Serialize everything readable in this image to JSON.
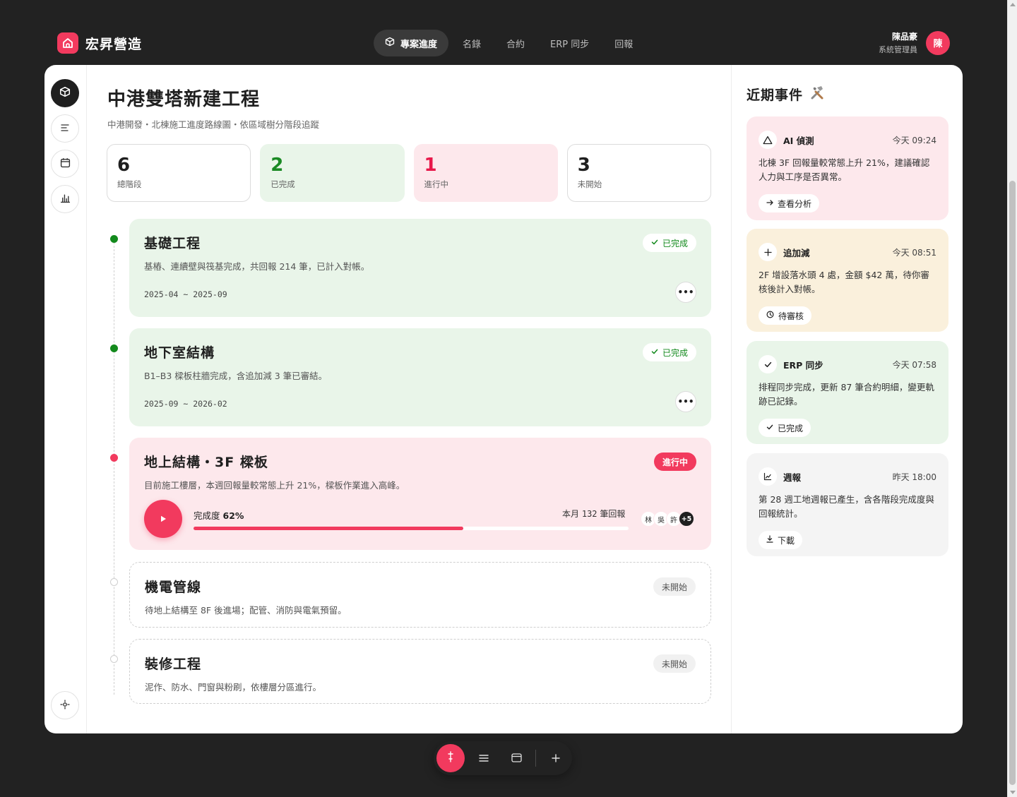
{
  "brand": {
    "name": "宏昇營造",
    "accent": "#f23a5e"
  },
  "nav": {
    "items": [
      {
        "label": "專案進度",
        "active": true
      },
      {
        "label": "名錄",
        "active": false
      },
      {
        "label": "合約",
        "active": false
      },
      {
        "label": "ERP 同步",
        "active": false
      },
      {
        "label": "回報",
        "active": false
      }
    ]
  },
  "user": {
    "name": "陳品豪",
    "role": "系統管理員",
    "initial": "陳"
  },
  "rail": {
    "icons": [
      "cube-icon",
      "list-icon",
      "calendar-icon",
      "bar-chart-icon",
      "locate-icon"
    ]
  },
  "project": {
    "title": "中港雙塔新建工程",
    "subtitle": "中港開發・北棟施工進度路線圖・依區域樹分階段追蹤"
  },
  "stats": [
    {
      "value": "6",
      "label": "總階段"
    },
    {
      "value": "2",
      "label": "已完成"
    },
    {
      "value": "1",
      "label": "進行中"
    },
    {
      "value": "3",
      "label": "未開始"
    }
  ],
  "phases": [
    {
      "title": "基礎工程",
      "status": "已完成",
      "desc": "基樁、連續壁與筏基完成，共回報 214 筆，已計入對帳。",
      "dates": "2025-04 ~ 2025-09"
    },
    {
      "title": "地下室結構",
      "status": "已完成",
      "desc": "B1–B3 樑板柱牆完成，含追加減 3 筆已審結。",
      "dates": "2025-09 ~ 2026-02"
    },
    {
      "title": "地上結構・3F 樑板",
      "status": "進行中",
      "desc": "目前施工樓層，本週回報量較常態上升 21%，樑板作業進入高峰。",
      "progress_label": "完成度",
      "progress_value": "62%",
      "progress": 0.62,
      "month_label": "本月",
      "month_count": "132",
      "month_unit": "筆回報",
      "members": [
        "林",
        "吳",
        "許"
      ],
      "members_more": "+5"
    },
    {
      "title": "機電管線",
      "status": "未開始",
      "desc": "待地上結構至 8F 後進場；配管、消防與電氣預留。"
    },
    {
      "title": "裝修工程",
      "status": "未開始",
      "desc": "泥作、防水、門窗與粉刷，依樓層分區進行。"
    }
  ],
  "events": {
    "title": "近期事件",
    "items": [
      {
        "name": "AI 偵測",
        "time": "今天 09:24",
        "body": "北棟 3F 回報量較常態上升 21%，建議確認人力與工序是否異常。",
        "action": "查看分析",
        "icon": "warning-icon"
      },
      {
        "name": "追加減",
        "time": "今天 08:51",
        "body": "2F 增設落水頭 4 處，金額 $42 萬，待你審核後計入對帳。",
        "action": "待審核",
        "icon": "plus-icon"
      },
      {
        "name": "ERP 同步",
        "time": "今天 07:58",
        "body": "排程同步完成，更新 87 筆合約明細，變更軌跡已記錄。",
        "action": "已完成",
        "icon": "check-icon"
      },
      {
        "name": "週報",
        "time": "昨天 18:00",
        "body": "第 28 週工地週報已產生，含各階段完成度與回報統計。",
        "action": "下載",
        "icon": "line-chart-icon"
      }
    ]
  },
  "colors": {
    "done": "#138a1d",
    "active": "#f23a5e",
    "done_bg": "#e9f5e9",
    "active_bg": "#fde8ec",
    "cream_bg": "#faf0dc"
  }
}
